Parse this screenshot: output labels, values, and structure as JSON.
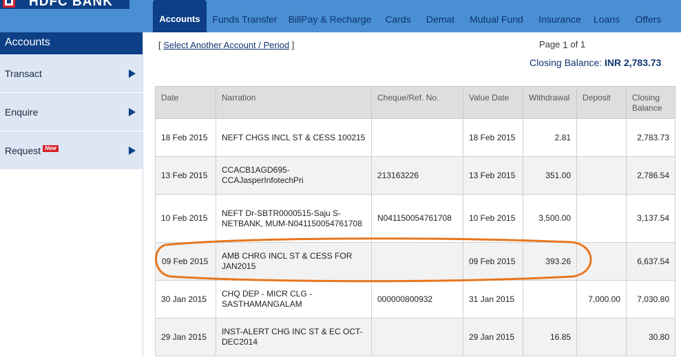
{
  "brand": {
    "name": "HDFC BANK"
  },
  "nav": {
    "items": [
      {
        "label": "Accounts",
        "active": true,
        "width": 78
      },
      {
        "label": "Funds Transfer",
        "active": false,
        "width": 111
      },
      {
        "label": "BillPay & Recharge",
        "active": false,
        "width": 136
      },
      {
        "label": "Cards",
        "active": false,
        "width": 62
      },
      {
        "label": "Demat",
        "active": false,
        "width": 61
      },
      {
        "label": "Mutual Fund",
        "active": false,
        "width": 102
      },
      {
        "label": "Insurance",
        "active": false,
        "width": 82
      },
      {
        "label": "Loans",
        "active": false,
        "width": 54
      },
      {
        "label": "Offers",
        "active": false,
        "width": 67
      }
    ]
  },
  "sidebar": {
    "title": "Accounts",
    "items": [
      {
        "label": "Transact",
        "badge": ""
      },
      {
        "label": "Enquire",
        "badge": ""
      },
      {
        "label": "Request",
        "badge": "New"
      }
    ]
  },
  "header": {
    "select_link": "Select Another Account / Period",
    "page_prefix": "Page",
    "page_current": "1",
    "page_of": "of 1",
    "closing_label": "Closing Balance:",
    "closing_value": "INR 2,783.73"
  },
  "table": {
    "columns": [
      "Date",
      "Narration",
      "Cheque/Ref. No.",
      "Value Date",
      "Withdrawal",
      "Deposit",
      "Closing Balance"
    ],
    "rows": [
      {
        "date": "18 Feb 2015",
        "narration": "NEFT CHGS INCL ST & CESS 100215",
        "ref": "",
        "value_date": "18 Feb 2015",
        "withdrawal": "2.81",
        "deposit": "",
        "balance": "2,783.73"
      },
      {
        "date": "13 Feb 2015",
        "narration": "CCACB1AGD695-CCAJasperInfotechPri",
        "ref": "213163226",
        "value_date": "13 Feb 2015",
        "withdrawal": "351.00",
        "deposit": "",
        "balance": "2,786.54"
      },
      {
        "date": "10 Feb 2015",
        "narration": "NEFT Dr-SBTR0000515-Saju S-NETBANK, MUM-N041150054761708",
        "ref": "N041150054761708",
        "value_date": "10 Feb 2015",
        "withdrawal": "3,500.00",
        "deposit": "",
        "balance": "3,137.54"
      },
      {
        "date": "09 Feb 2015",
        "narration": "AMB CHRG INCL ST & CESS FOR JAN2015",
        "ref": "",
        "value_date": "09 Feb 2015",
        "withdrawal": "393.26",
        "deposit": "",
        "balance": "6,637.54"
      },
      {
        "date": "30 Jan 2015",
        "narration": "CHQ DEP - MICR CLG - SASTHAMANGALAM",
        "ref": "000000800932",
        "value_date": "31 Jan 2015",
        "withdrawal": "",
        "deposit": "7,000.00",
        "balance": "7,030.80"
      },
      {
        "date": "29 Jan 2015",
        "narration": "INST-ALERT CHG INC ST & EC OCT-DEC2014",
        "ref": "",
        "value_date": "29 Jan 2015",
        "withdrawal": "16.85",
        "deposit": "",
        "balance": "30.80"
      }
    ]
  },
  "colors": {
    "brand_navy": "#0d3f86",
    "nav_blue": "#4a8fd3",
    "sidebar_item": "#dde6f3",
    "highlight_orange": "#e8761e",
    "logo_red": "#d8232a"
  }
}
